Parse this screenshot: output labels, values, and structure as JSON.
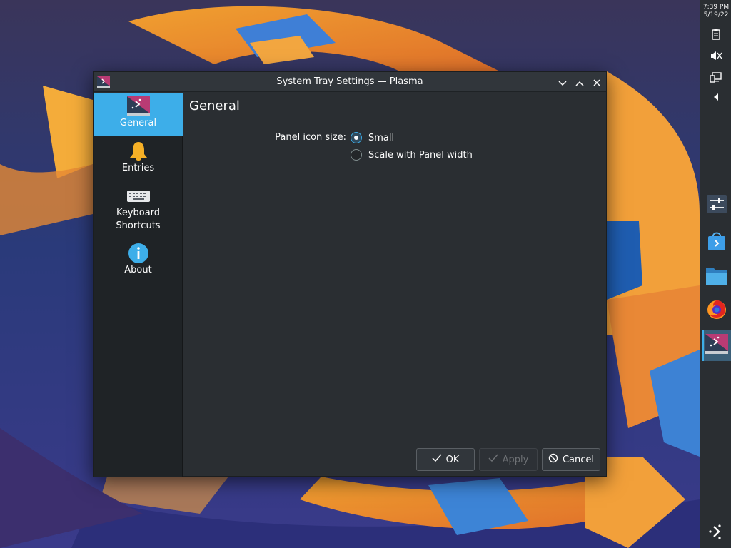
{
  "window": {
    "title": "System Tray Settings — Plasma"
  },
  "sidebar": {
    "items": [
      {
        "label": "General",
        "icon": "plasma-config-icon",
        "selected": true
      },
      {
        "label": "Entries",
        "icon": "bell-icon",
        "selected": false
      },
      {
        "label": "Keyboard Shortcuts",
        "icon": "keyboard-icon",
        "selected": false
      },
      {
        "label": "About",
        "icon": "info-icon",
        "selected": false
      }
    ]
  },
  "page": {
    "title": "General",
    "field_label": "Panel icon size:",
    "options": [
      {
        "label": "Small",
        "checked": true
      },
      {
        "label": "Scale with Panel width",
        "checked": false
      }
    ]
  },
  "buttons": {
    "ok": "OK",
    "apply": "Apply",
    "cancel": "Cancel"
  },
  "panel": {
    "time": "7:39 PM",
    "date": "5/19/22",
    "tray_icons": [
      "clipboard-icon",
      "volume-muted-icon",
      "display-icon",
      "expand-arrow-icon"
    ],
    "tasks": [
      "system-settings-icon",
      "discover-store-icon",
      "dolphin-folder-icon",
      "firefox-icon",
      "plasma-config-icon"
    ],
    "launcher": "kde-launcher-icon"
  },
  "colors": {
    "accent": "#3daee9",
    "window_bg": "#2a2e32",
    "sidebar_bg": "#1f2326",
    "titlebar_bg": "#31363b"
  }
}
